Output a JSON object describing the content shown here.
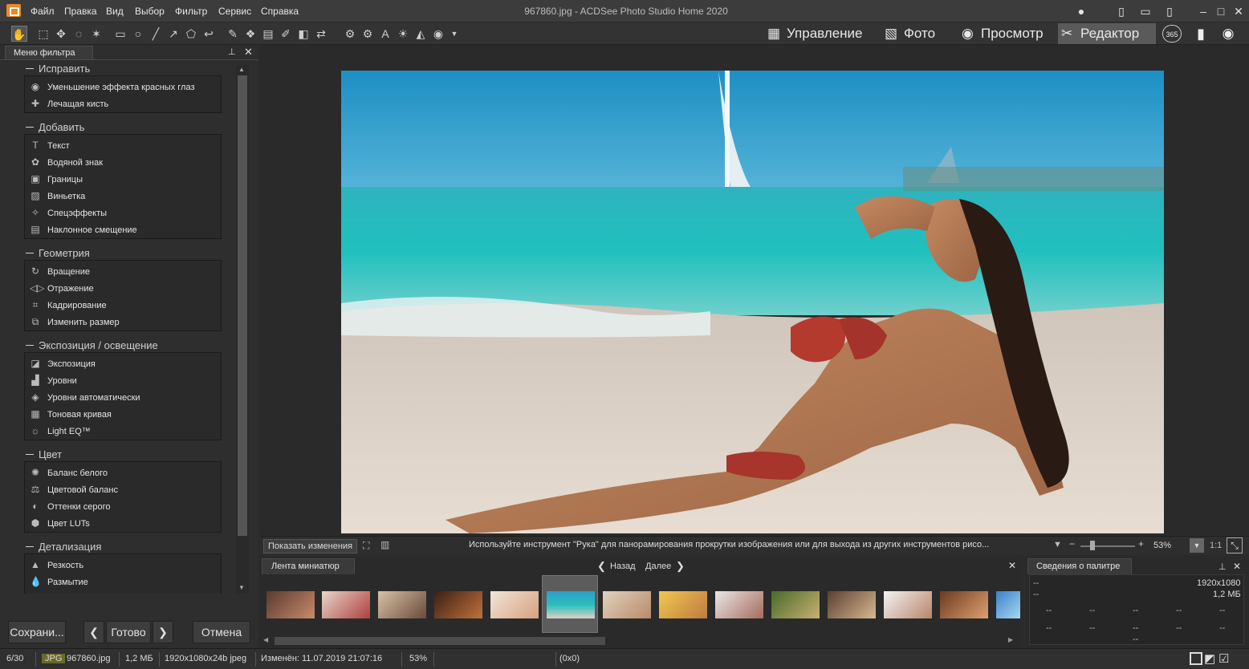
{
  "window": {
    "title": "967860.jpg - ACDSee Photo Studio Home 2020",
    "menu": [
      "Файл",
      "Правка",
      "Вид",
      "Выбор",
      "Фильтр",
      "Сервис",
      "Справка"
    ]
  },
  "modes": {
    "manage": "Управление",
    "photos": "Фото",
    "view": "Просмотр",
    "edit": "Редактор",
    "badge": "365"
  },
  "filter_panel": {
    "title": "Меню фильтра",
    "groups": [
      {
        "title": "Исправить",
        "items": [
          {
            "label": "Уменьшение эффекта красных глаз",
            "icon": "eye-icon"
          },
          {
            "label": "Лечащая кисть",
            "icon": "bandage-icon"
          }
        ]
      },
      {
        "title": "Добавить",
        "items": [
          {
            "label": "Текст",
            "icon": "text-icon"
          },
          {
            "label": "Водяной знак",
            "icon": "watermark-icon"
          },
          {
            "label": "Границы",
            "icon": "borders-icon"
          },
          {
            "label": "Виньетка",
            "icon": "vignette-icon"
          },
          {
            "label": "Спецэффекты",
            "icon": "magic-wand-icon"
          },
          {
            "label": "Наклонное смещение",
            "icon": "tilt-shift-icon"
          }
        ]
      },
      {
        "title": "Геометрия",
        "items": [
          {
            "label": "Вращение",
            "icon": "rotate-icon"
          },
          {
            "label": "Отражение",
            "icon": "flip-icon"
          },
          {
            "label": "Кадрирование",
            "icon": "crop-icon"
          },
          {
            "label": "Изменить размер",
            "icon": "resize-icon"
          }
        ]
      },
      {
        "title": "Экспозиция / освещение",
        "items": [
          {
            "label": "Экспозиция",
            "icon": "exposure-icon"
          },
          {
            "label": "Уровни",
            "icon": "levels-icon"
          },
          {
            "label": "Уровни автоматически",
            "icon": "auto-levels-icon"
          },
          {
            "label": "Тоновая кривая",
            "icon": "tone-curve-icon"
          },
          {
            "label": "Light EQ™",
            "icon": "light-eq-icon"
          }
        ]
      },
      {
        "title": "Цвет",
        "items": [
          {
            "label": "Баланс белого",
            "icon": "white-balance-icon"
          },
          {
            "label": "Цветовой баланс",
            "icon": "color-balance-icon"
          },
          {
            "label": "Оттенки серого",
            "icon": "grayscale-icon"
          },
          {
            "label": "Цвет LUTs",
            "icon": "lut-icon"
          }
        ]
      },
      {
        "title": "Детализация",
        "items": [
          {
            "label": "Резкость",
            "icon": "sharpen-icon"
          },
          {
            "label": "Размытие",
            "icon": "blur-icon"
          }
        ]
      }
    ],
    "save_button": "Сохрани...",
    "done_button": "Готово",
    "cancel_button": "Отмена"
  },
  "viewer": {
    "show_changes": "Показать изменения",
    "hint": "Используйте инструмент \"Рука\" для панорамирования прокрутки изображения или для выхода из других инструментов рисо...",
    "zoom": "53%",
    "zoom_ratio": "1:1"
  },
  "filmstrip": {
    "title": "Лента миниатюр",
    "back": "Назад",
    "next": "Далее",
    "selected_index": 4
  },
  "properties": {
    "title": "Сведения о палитре",
    "dims": "1920x1080",
    "size": "1,2 МБ",
    "dash": "--"
  },
  "status": {
    "position": "6/30",
    "format": "JPG",
    "filename": "967860.jpg",
    "filesize": "1,2 МБ",
    "dimensions": "1920x1080x24b jpeg",
    "modified": "Изменён: 11.07.2019 21:07:16",
    "zoom": "53%",
    "coords": "(0x0)"
  }
}
